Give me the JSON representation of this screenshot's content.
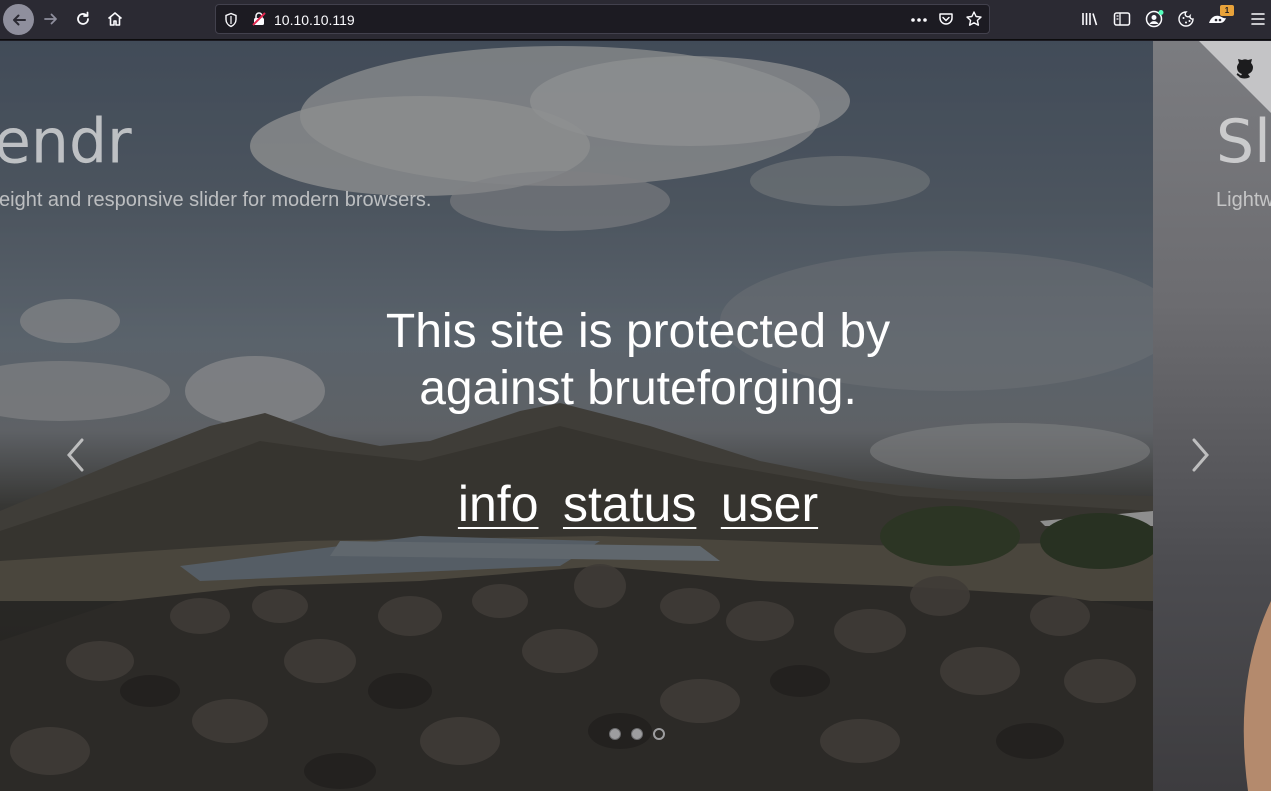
{
  "browser": {
    "url": "10.10.10.119",
    "extension_badge": "1",
    "icons": [
      "back-arrow-icon",
      "forward-arrow-icon",
      "reload-icon",
      "home-icon",
      "shield-icon",
      "insecure-lock-icon",
      "more-options-icon",
      "pocket-icon",
      "bookmark-star-icon",
      "library-icon",
      "sidebar-icon",
      "account-icon",
      "cookie-icon",
      "extension-icon",
      "menu-icon"
    ]
  },
  "slider": {
    "current": {
      "title": "endr",
      "subtitle": "eight and responsive slider for modern browsers."
    },
    "next": {
      "title": "Sl",
      "subtitle": "Lightw"
    },
    "dots": 3,
    "active_dot": 3
  },
  "message": {
    "line1": "This site is protected by",
    "line2": "against bruteforging."
  },
  "links": [
    "info",
    "status",
    "user"
  ]
}
